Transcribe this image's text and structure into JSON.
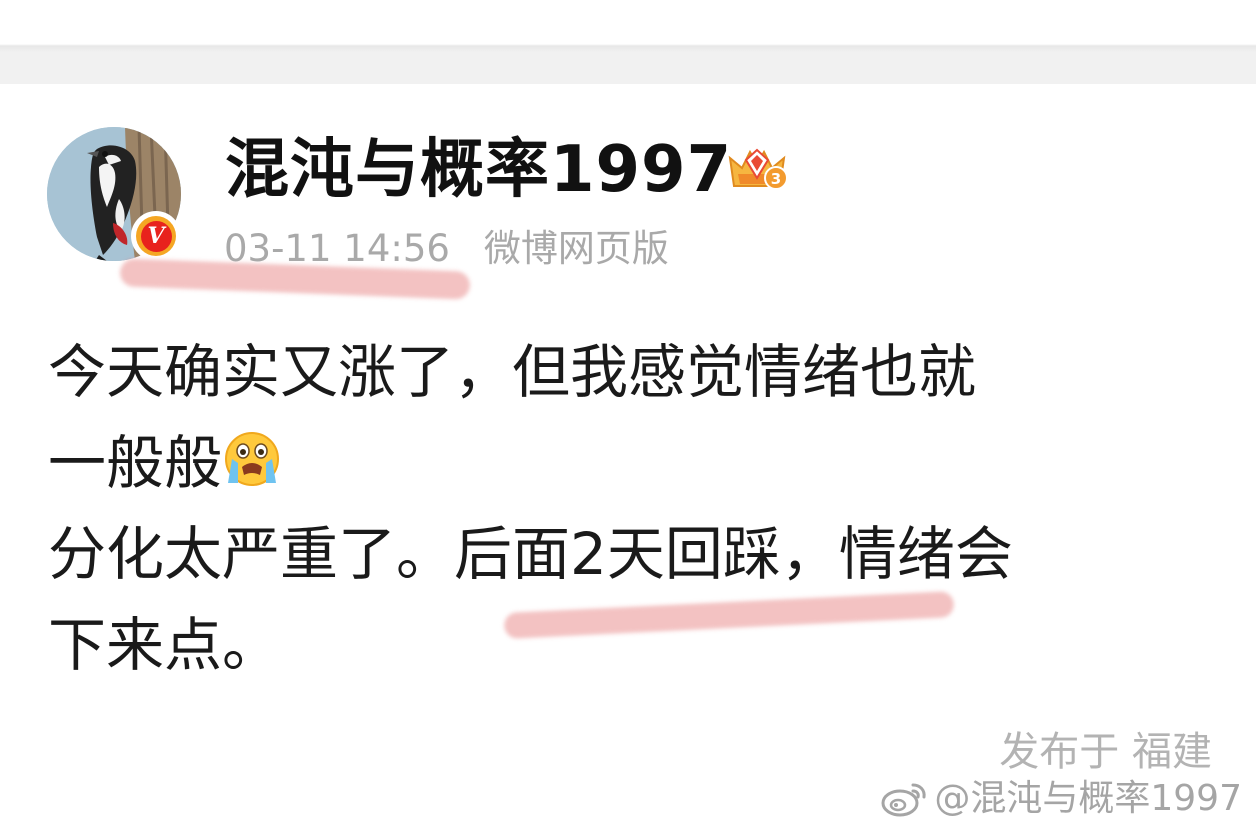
{
  "author": {
    "name": "混沌与概率1997",
    "verified_mark": "V",
    "level_badge_icon": "crown-level-badge-icon",
    "level_number": "3",
    "avatar_icon": "woodpecker-avatar-icon"
  },
  "post": {
    "timestamp": "03-11 14:56",
    "source": "微博网页版",
    "paragraphs": [
      "今天确实又涨了，但我感觉情绪也就",
      "一般般",
      "分化太严重了。后面2天回踩，情绪会",
      "下来点。"
    ],
    "emoji_icon": "crying-face-emoji-icon",
    "location": "发布于 福建"
  },
  "watermark": {
    "icon": "weibo-logo-icon",
    "text": "@混沌与概率1997"
  },
  "colors": {
    "text_primary": "#1a1a1a",
    "text_meta": "#a9a9a9",
    "highlight": "#e26e6e",
    "verified_orange": "#f5a623",
    "verified_red": "#e8221d",
    "background_band": "#f1f1f1"
  }
}
